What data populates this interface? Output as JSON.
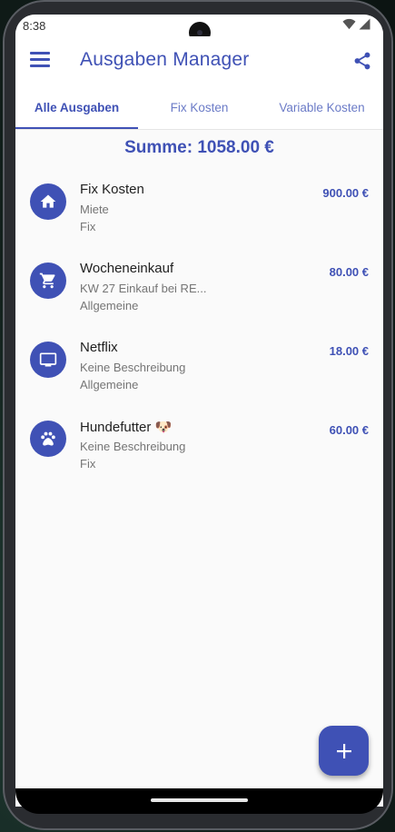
{
  "status_bar": {
    "time": "8:38"
  },
  "app_bar": {
    "title": "Ausgaben Manager",
    "menu_icon": "menu-icon",
    "share_icon": "share-icon"
  },
  "tabs": [
    {
      "label": "Alle Ausgaben",
      "active": true
    },
    {
      "label": "Fix Kosten",
      "active": false
    },
    {
      "label": "Variable Kosten",
      "active": false
    }
  ],
  "summary": {
    "text": "Summe: 1058.00 €"
  },
  "expenses": [
    {
      "icon": "home-icon",
      "title": "Fix Kosten",
      "description": "Miete",
      "category": "Fix",
      "amount": "900.00 €"
    },
    {
      "icon": "shopping-cart-icon",
      "title": "Wocheneinkauf",
      "description": "KW 27 Einkauf bei RE...",
      "category": "Allgemeine",
      "amount": "80.00 €"
    },
    {
      "icon": "monitor-icon",
      "title": "Netflix",
      "description": "Keine Beschreibung",
      "category": "Allgemeine",
      "amount": "18.00 €"
    },
    {
      "icon": "paw-icon",
      "title": "Hundefutter 🐶",
      "description": "Keine Beschreibung",
      "category": "Fix",
      "amount": "60.00 €"
    }
  ],
  "fab": {
    "icon": "add-icon",
    "label": "+"
  },
  "colors": {
    "primary": "#3f51b5",
    "tab_inactive": "#6b7bc7",
    "text_secondary": "#757575",
    "background": "#fafafa"
  }
}
